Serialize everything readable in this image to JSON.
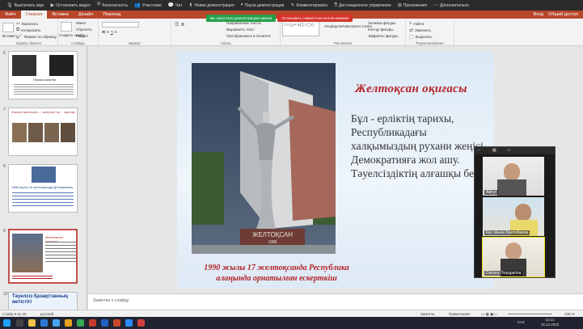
{
  "zoombar": {
    "items": [
      {
        "icon": "mic-icon",
        "label": "Выключить звук",
        "red": false
      },
      {
        "icon": "video-icon",
        "label": "Остановить видео",
        "red": false
      },
      {
        "icon": "shield-icon",
        "label": "Безопасность",
        "red": false
      },
      {
        "icon": "participants-icon",
        "label": "Участники",
        "red": false
      },
      {
        "icon": "chat-icon",
        "label": "Чат",
        "red": false
      },
      {
        "icon": "share-icon",
        "label": "Новая демонстрация",
        "red": false
      },
      {
        "icon": "pause-icon",
        "label": "Пауза демонстрации",
        "red": false
      },
      {
        "icon": "annotate-icon",
        "label": "Комментировать",
        "red": false
      },
      {
        "icon": "remote-icon",
        "label": "Дистанционное управление",
        "red": false
      },
      {
        "icon": "apps-icon",
        "label": "Приложения",
        "red": false
      },
      {
        "icon": "more-icon",
        "label": "Дополнительно",
        "red": false
      }
    ]
  },
  "share": {
    "status": "Вы запустили демонстрацию экрана",
    "stop": "Остановить совместное использование"
  },
  "tabs": {
    "items": [
      "Файл",
      "Главная",
      "Вставка",
      "Дизайн",
      "Переход"
    ],
    "active_index": 1,
    "account": "Вход",
    "shared": "Общий доступ"
  },
  "ribbon": {
    "clipboard": {
      "paste": "Вставить",
      "cut": "Вырезать",
      "copy": "Копировать",
      "format": "Формат по образцу",
      "label": "Буфер обмена"
    },
    "slides": {
      "new": "Создать слайд",
      "layout": "Макет",
      "reset": "Сбросить",
      "section": "Раздел",
      "label": "Слайды"
    },
    "font": {
      "label": "Шрифт"
    },
    "paragraph": {
      "direction": "Направление текста",
      "align": "Выровнять текст",
      "smartart": "Преобразовать в SmartArt",
      "label": "Абзац"
    },
    "drawing": {
      "arrange": "Упорядочить",
      "styles": "Экспресс-стили",
      "fill": "Заливка фигуры",
      "outline": "Контур фигуры",
      "effects": "Эффекты фигуры",
      "label": "Рисование"
    },
    "editing": {
      "find": "Найти",
      "replace": "Заменить",
      "select": "Выделить",
      "label": "Редактирование"
    }
  },
  "slide_panel": {
    "thumbs": [
      {
        "num": "6",
        "title": "Первая жертва"
      },
      {
        "num": "7",
        "title": "Жалын азаттықта ... көтерген ер ... жастар"
      },
      {
        "num": "8",
        "title": "1986 жылы 16 желтоқсанда Д.Конаевтың"
      },
      {
        "num": "9",
        "title": "Желтоксан окигасы"
      },
      {
        "num": "10",
        "title": "Тәуелсіз Қазақстанның жетістігі"
      }
    ]
  },
  "slide": {
    "title": "Желтоқсан оқиғасы",
    "body": "Бұл - ерліктің тарихы, Республикадағы халқымыздың рухани жеңісі. Демократияға жол ашу. Тәуелсіздіктің алғашқы беті",
    "caption": "1990 жылы 17 желтоқсанда Республика алаңында орнатылған ескерткіш",
    "monument_text": "ЖЕЛТОҚСАН",
    "monument_year": "1986"
  },
  "notes": {
    "placeholder": "Заметки к слайду"
  },
  "status": {
    "slide": "Слайд 9 из 40",
    "lang": "русский",
    "notes": "Заметки",
    "comments": "Примечания",
    "zoom": "109 %"
  },
  "zoom_panel": {
    "participants": [
      {
        "name": "Айгул"
      },
      {
        "name": "Кас Шына Балтабаева"
      },
      {
        "name": "Danara Orazgazina"
      }
    ]
  },
  "taskbar": {
    "lang": "KAZ",
    "time": "13:11",
    "date": "15.12.2022"
  }
}
